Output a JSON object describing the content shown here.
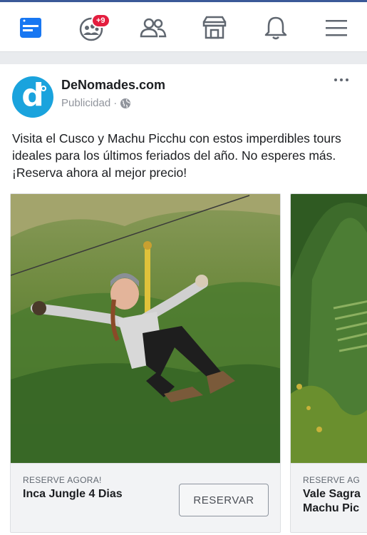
{
  "nav": {
    "notification_badge": "+9",
    "accent": "#1877f2"
  },
  "post": {
    "page_name": "DeNomades.com",
    "avatar_letter": "d",
    "sponsored": "Publicidad",
    "sponsored_separator": "·",
    "text": "Visita el Cusco y Machu Picchu con estos imperdibles tours ideales para los últimos feriados del año. No esperes más. ¡Reserva ahora al mejor precio!",
    "cards": [
      {
        "cta_small": "RESERVE AGORA!",
        "title": "Inca Jungle 4 Dias",
        "button": "RESERVAR"
      },
      {
        "cta_small": "RESERVE AG",
        "title_line1": "Vale Sagra",
        "title_line2": "Machu Pic"
      }
    ]
  }
}
